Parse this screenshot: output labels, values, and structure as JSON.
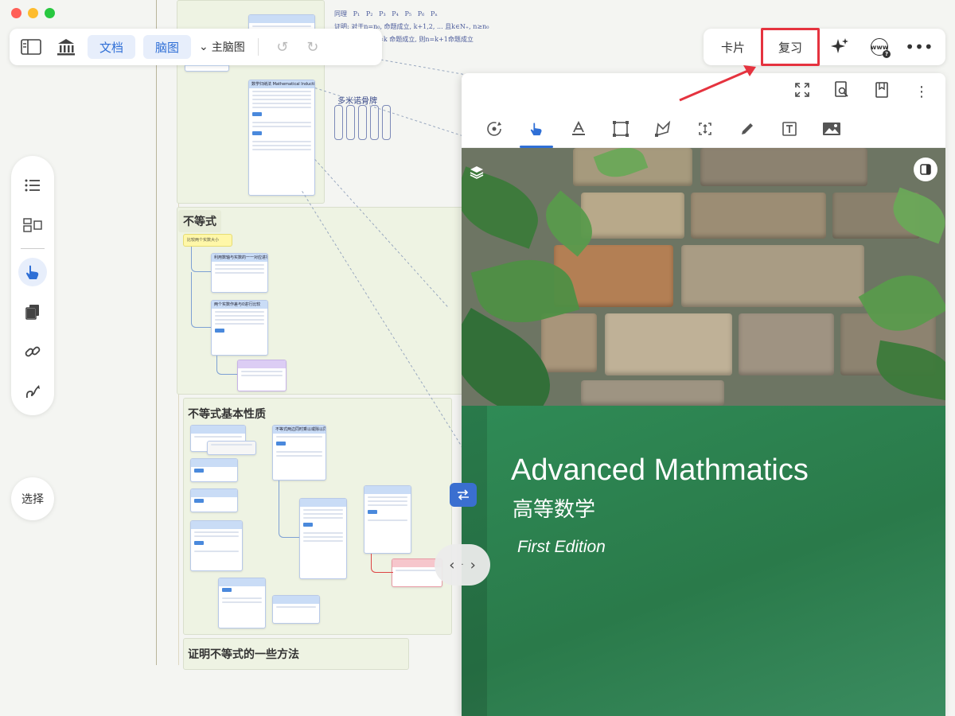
{
  "toolbar_left": {
    "doc_label": "文档",
    "mindmap_label": "脑图",
    "main_mindmap_label": "主脑图"
  },
  "toolbar_right": {
    "card_label": "卡片",
    "review_label": "复习"
  },
  "sidebar": {
    "select_label": "选择"
  },
  "canvas": {
    "group_titles": [
      "不等式",
      "不等式基本性质",
      "证明不等式的一些方法"
    ],
    "yellow_note": "比较两个实数大小",
    "hand_title": "多米诺骨牌",
    "top_card_1": "数学归纳法 Mathematical Induction",
    "card_header_1": "利用数轴与实数的一一对应进行比较",
    "card_header_2": "两个实数作差与0进行比较",
    "card_header_3": "不等式两边同时乘以或除以同一个数"
  },
  "book": {
    "title": "Advanced Mathmatics",
    "subtitle": "高等数学",
    "edition": "First Edition"
  },
  "colors": {
    "accent": "#2f6fd6",
    "highlight": "#e5333f",
    "book_green": "#2f8b56"
  }
}
